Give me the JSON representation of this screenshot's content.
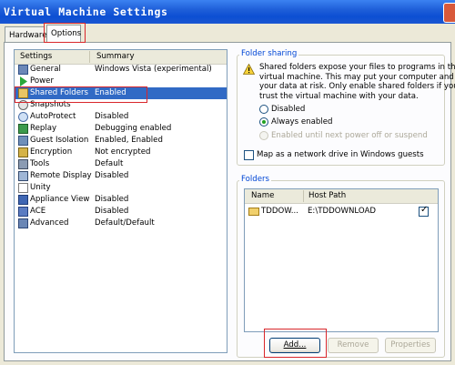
{
  "window": {
    "title": "Virtual Machine Settings"
  },
  "tabs": [
    {
      "label": "Hardware"
    },
    {
      "label": "Options"
    }
  ],
  "settings_list": {
    "headers": {
      "settings": "Settings",
      "summary": "Summary"
    },
    "items": [
      {
        "name": "General",
        "summary": "Windows Vista (experimental)",
        "icon": "general-icon"
      },
      {
        "name": "Power",
        "summary": "",
        "icon": "power-icon"
      },
      {
        "name": "Shared Folders",
        "summary": "Enabled",
        "icon": "shared-folders-icon"
      },
      {
        "name": "Snapshots",
        "summary": "",
        "icon": "snapshots-icon"
      },
      {
        "name": "AutoProtect",
        "summary": "Disabled",
        "icon": "autoprotect-icon"
      },
      {
        "name": "Replay",
        "summary": "Debugging enabled",
        "icon": "replay-icon"
      },
      {
        "name": "Guest Isolation",
        "summary": "Enabled, Enabled",
        "icon": "guest-isolation-icon"
      },
      {
        "name": "Encryption",
        "summary": "Not encrypted",
        "icon": "encryption-icon"
      },
      {
        "name": "Tools",
        "summary": "Default",
        "icon": "tools-icon"
      },
      {
        "name": "Remote Display",
        "summary": "Disabled",
        "icon": "remote-display-icon"
      },
      {
        "name": "Unity",
        "summary": "",
        "icon": "unity-icon"
      },
      {
        "name": "Appliance View",
        "summary": "Disabled",
        "icon": "appliance-view-icon"
      },
      {
        "name": "ACE",
        "summary": "Disabled",
        "icon": "ace-icon"
      },
      {
        "name": "Advanced",
        "summary": "Default/Default",
        "icon": "advanced-icon"
      }
    ],
    "selected": "Shared Folders"
  },
  "folder_sharing": {
    "label": "Folder sharing",
    "warning_lines": [
      "Shared folders expose your files to programs in the",
      "virtual machine. This may put your computer and",
      "your data at risk. Only enable shared folders if you",
      "trust the virtual machine with your data."
    ],
    "options": [
      {
        "label": "Disabled"
      },
      {
        "label": "Always enabled"
      },
      {
        "label": "Enabled until next power off or suspend"
      }
    ],
    "selected_option": "Always enabled",
    "map_drive": {
      "label": "Map as a network drive in Windows guests",
      "checked": false
    }
  },
  "folders": {
    "label": "Folders",
    "columns": [
      "Name",
      "Host Path"
    ],
    "rows": [
      {
        "name": "TDDOW...",
        "host_path": "E:\\TDDOWNLOAD",
        "enabled": true
      }
    ],
    "buttons": {
      "add": "Add...",
      "remove": "Remove",
      "properties": "Properties"
    }
  },
  "colors": {
    "selection": "#316ac5",
    "highlight_box": "#d9262b",
    "group_label": "#0046d5"
  }
}
